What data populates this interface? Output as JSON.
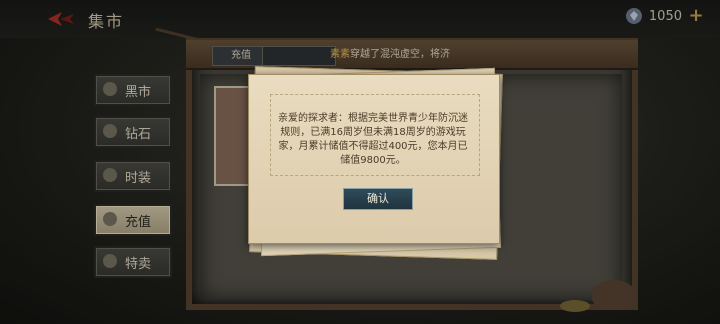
{
  "header": {
    "title": "集市"
  },
  "currency": {
    "amount": "1050"
  },
  "board": {
    "tabs": [
      "充值",
      ""
    ],
    "marquee_highlight": "素素",
    "marquee_text": "穿越了混沌虚空，将济"
  },
  "sidebar": {
    "items": [
      {
        "label": "黑市",
        "icon": "black-market-icon"
      },
      {
        "label": "钻石",
        "icon": "diamond-icon"
      },
      {
        "label": "时装",
        "icon": "fashion-icon"
      },
      {
        "label": "充值",
        "icon": "recharge-icon",
        "active": true
      },
      {
        "label": "特卖",
        "icon": "sale-icon"
      }
    ]
  },
  "dialog": {
    "message": "亲爱的探求者：根据完美世界青少年防沉迷规则，已满16周岁但未满18周岁的游戏玩家，月累计储值不得超过400元，您本月已储值9800元。",
    "confirm_label": "确认"
  },
  "colors": {
    "accent": "#c9a552",
    "button": "#2f4b59",
    "paper": "#e9dcc0"
  }
}
